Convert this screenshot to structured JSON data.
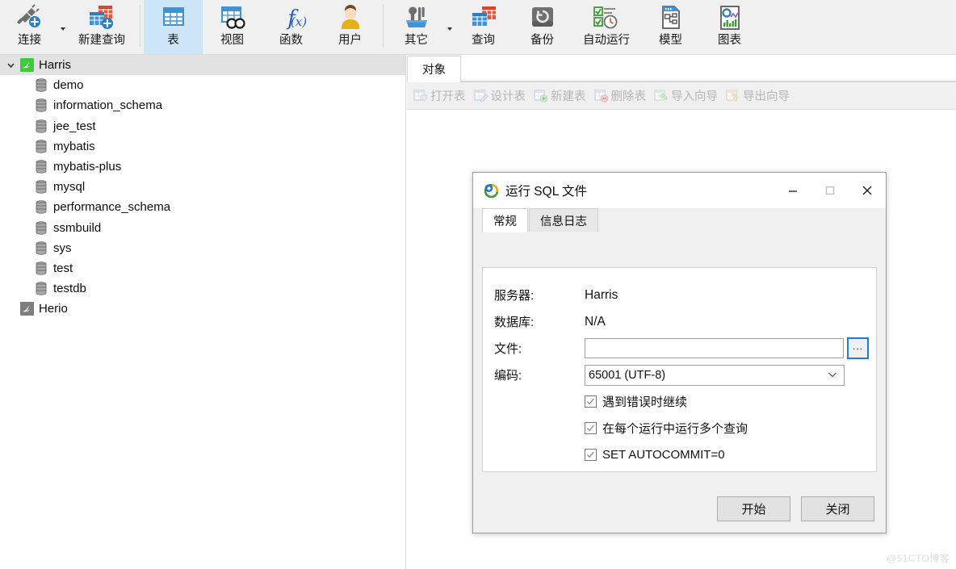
{
  "toolbar": {
    "groups": [
      {
        "items": [
          {
            "label": "连接",
            "icon": "connect-icon",
            "caret": true
          },
          {
            "label": "新建查询",
            "icon": "new-query-icon",
            "caret": false
          }
        ]
      },
      {
        "items": [
          {
            "label": "表",
            "icon": "table-icon",
            "selected": true
          },
          {
            "label": "视图",
            "icon": "view-icon"
          },
          {
            "label": "函数",
            "icon": "function-icon"
          },
          {
            "label": "用户",
            "icon": "user-icon"
          }
        ]
      },
      {
        "items": [
          {
            "label": "其它",
            "icon": "other-tools-icon",
            "caret": true
          },
          {
            "label": "查询",
            "icon": "query-icon"
          },
          {
            "label": "备份",
            "icon": "backup-icon"
          },
          {
            "label": "自动运行",
            "icon": "automation-icon"
          },
          {
            "label": "模型",
            "icon": "model-icon"
          },
          {
            "label": "图表",
            "icon": "chart-icon"
          }
        ]
      }
    ]
  },
  "sidebar": {
    "connections": [
      {
        "name": "Harris",
        "expanded": true,
        "selected": true,
        "status": "connected",
        "databases": [
          "demo",
          "information_schema",
          "jee_test",
          "mybatis",
          "mybatis-plus",
          "mysql",
          "performance_schema",
          "ssmbuild",
          "sys",
          "test",
          "testdb"
        ]
      },
      {
        "name": "Herio",
        "expanded": false,
        "selected": false,
        "status": "disconnected",
        "databases": []
      }
    ]
  },
  "main": {
    "tabs": [
      {
        "label": "对象",
        "active": true
      }
    ],
    "object_toolbar": [
      {
        "label": "打开表",
        "icon": "open-table-icon",
        "enabled": false
      },
      {
        "label": "设计表",
        "icon": "design-table-icon",
        "enabled": false
      },
      {
        "label": "新建表",
        "icon": "new-table-icon",
        "enabled": false
      },
      {
        "label": "删除表",
        "icon": "delete-table-icon",
        "enabled": false
      },
      {
        "label": "导入向导",
        "icon": "import-wizard-icon",
        "enabled": false
      },
      {
        "label": "导出向导",
        "icon": "export-wizard-icon",
        "enabled": false
      }
    ]
  },
  "dialog": {
    "title": "运行 SQL 文件",
    "logo_icon": "navicat-logo-icon",
    "window_controls": {
      "minimize": "minimize-icon",
      "maximize": "maximize-icon",
      "close": "close-icon"
    },
    "tabs": [
      {
        "label": "常规",
        "active": true
      },
      {
        "label": "信息日志",
        "active": false
      }
    ],
    "form": {
      "server_label": "服务器:",
      "server_value": "Harris",
      "database_label": "数据库:",
      "database_value": "N/A",
      "file_label": "文件:",
      "file_value": "",
      "file_placeholder": "",
      "browse_label": "...",
      "encoding_label": "编码:",
      "encoding_value": "65001 (UTF-8)",
      "encoding_options": [
        "65001 (UTF-8)"
      ],
      "checkboxes": [
        {
          "label": "遇到错误时继续",
          "checked": true
        },
        {
          "label": "在每个运行中运行多个查询",
          "checked": true
        },
        {
          "label": "SET AUTOCOMMIT=0",
          "checked": true
        }
      ]
    },
    "buttons": {
      "start": "开始",
      "close": "关闭"
    }
  },
  "watermark": "@51CTO博客",
  "colors": {
    "accent_blue": "#1b7fd4",
    "selection_blue": "#cce5f7",
    "toolbar_bg": "#f0f0f0",
    "tree_selection": "#e2e2e2"
  }
}
